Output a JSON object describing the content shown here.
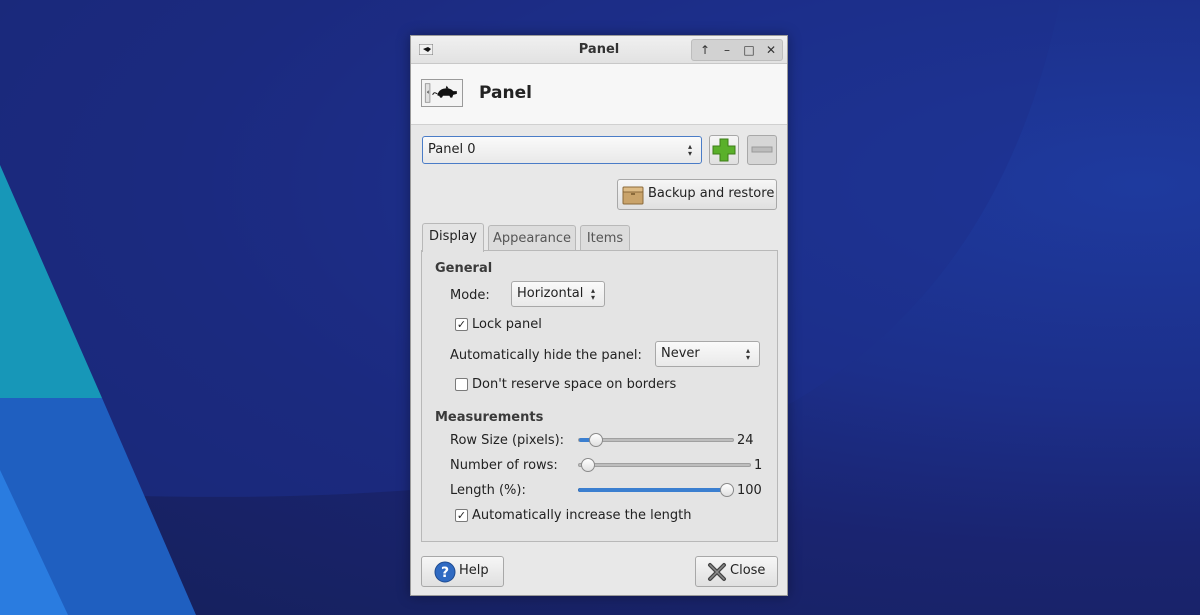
{
  "window": {
    "title": "Panel",
    "header_title": "Panel",
    "wm_buttons": [
      "↑",
      "–",
      "□",
      "✕"
    ]
  },
  "panel_selector": {
    "value": "Panel 0"
  },
  "backup_restore_label": "Backup and restore",
  "tabs": [
    {
      "label": "Display",
      "active": true
    },
    {
      "label": "Appearance",
      "active": false
    },
    {
      "label": "Items",
      "active": false
    }
  ],
  "general": {
    "heading": "General",
    "mode_label": "Mode:",
    "mode_value": "Horizontal",
    "lock_panel_label": "Lock panel",
    "lock_panel_checked": true,
    "autohide_label": "Automatically hide the panel:",
    "autohide_value": "Never",
    "reserve_label": "Don't reserve space on borders",
    "reserve_checked": false
  },
  "measurements": {
    "heading": "Measurements",
    "row_size_label": "Row Size (pixels):",
    "row_size_value": "24",
    "rows_label": "Number of rows:",
    "rows_value": "1",
    "length_label": "Length (%):",
    "length_value": "100",
    "auto_length_label": "Automatically increase the length",
    "auto_length_checked": true,
    "row_size_fraction": 0.09,
    "rows_fraction": 0.0,
    "length_fraction": 1.0
  },
  "footer": {
    "help_label": "Help",
    "close_label": "Close"
  },
  "colors": {
    "accent": "#3b7fd0",
    "add_green": "#5ab02a",
    "help_blue": "#2f6ac2"
  }
}
